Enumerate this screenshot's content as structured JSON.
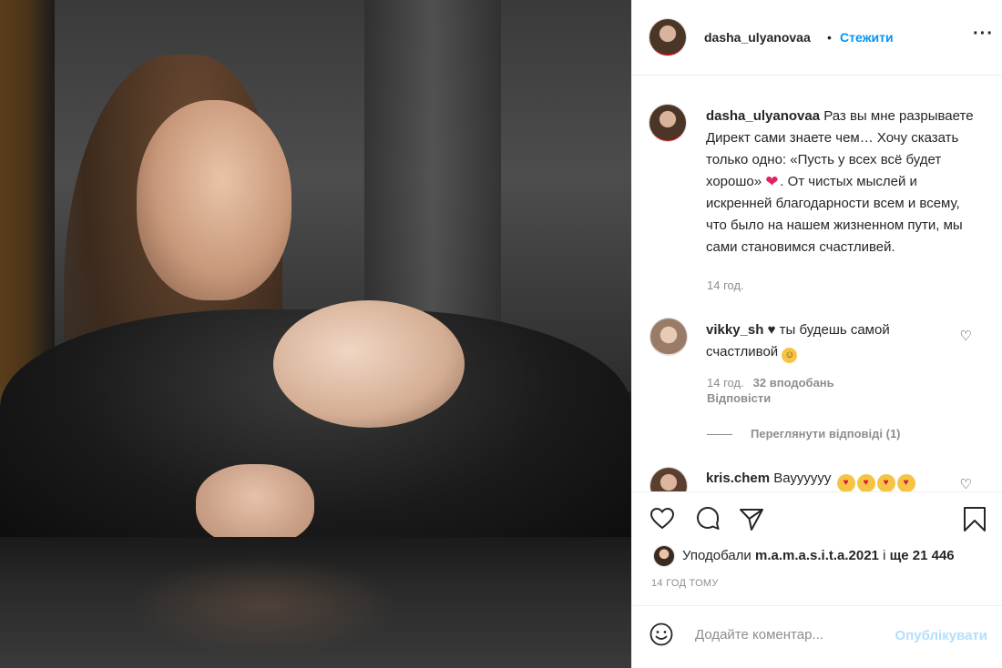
{
  "post": {
    "username": "dasha_ulyanovaa",
    "dot": "•",
    "follow_label": "Стежити",
    "more_label": "···"
  },
  "caption": {
    "username": "dasha_ulyanovaa",
    "text_before_heart": "Раз вы мне разрываете Директ сами знаете чем… Хочу сказать только одно: «Пусть у всех всё будет хорошо»",
    "heart": "❤",
    "text_after_heart": ". От чистых мыслей и искренней благодарности всем и всему, что было на нашем жизненном пути, мы сами становимся счастливей.",
    "time": "14 год."
  },
  "comments": [
    {
      "username": "vikky_sh",
      "text": "♥ ты будешь самой счастливой",
      "emoji": "☺",
      "time": "14 год.",
      "likes": "32 вподобань",
      "reply_label": "Відповісти",
      "view_replies": "Переглянути відповіді (1)"
    },
    {
      "username": "kris.chem",
      "text": "Вауууууу",
      "emojis": [
        "♥",
        "♥",
        "♥",
        "♥"
      ]
    }
  ],
  "icons": {
    "like": "heart-outline-icon",
    "comment": "comment-bubble-icon",
    "share": "paper-plane-icon",
    "save": "bookmark-icon",
    "comment_like": "♡",
    "emoji": "smiley-icon"
  },
  "likes": {
    "prefix": "Уподобали",
    "user": "m.a.m.a.s.i.t.a.2021",
    "middle": "і",
    "count": "ще 21 446"
  },
  "time_ago": "14 ГОД ТОМУ",
  "add_comment": {
    "placeholder": "Додайте коментар...",
    "post_label": "Опублікувати"
  },
  "colors": {
    "link": "#0095f6",
    "post_disabled": "#b2dffc",
    "muted": "#8e8e8e",
    "heart_red": "#e0245e"
  }
}
